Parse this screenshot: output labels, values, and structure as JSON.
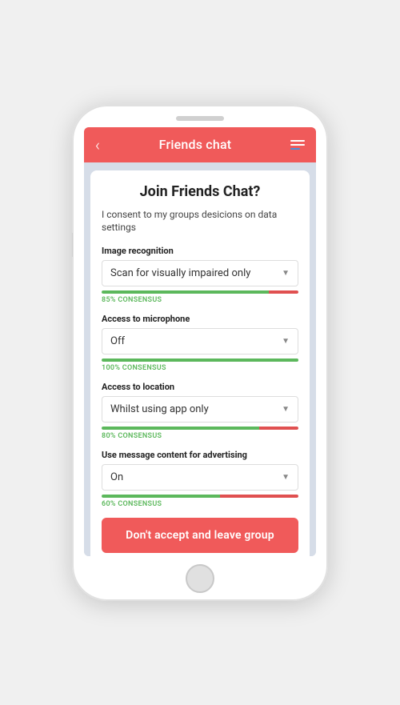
{
  "header": {
    "back_label": "‹",
    "title": "Friends chat",
    "menu_icon": "menu-icon"
  },
  "card": {
    "title": "Join Friends Chat?",
    "subtitle": "I consent to my groups desicions on data settings",
    "settings": [
      {
        "id": "image-recognition",
        "label": "Image recognition",
        "value": "Scan for visually impaired only",
        "consensus_pct": 85,
        "consensus_text": "85% CONSENSUS"
      },
      {
        "id": "access-microphone",
        "label": "Access to microphone",
        "value": "Off",
        "consensus_pct": 100,
        "consensus_text": "100% CONSENSUS"
      },
      {
        "id": "access-location",
        "label": "Access to location",
        "value": "Whilst using app only",
        "consensus_pct": 80,
        "consensus_text": "80% CONSENSUS"
      },
      {
        "id": "advertising",
        "label": "Use message content for advertising",
        "value": "On",
        "consensus_pct": 60,
        "consensus_text": "60% CONSENSUS"
      }
    ],
    "reject_button": "Don't accept and leave group"
  }
}
